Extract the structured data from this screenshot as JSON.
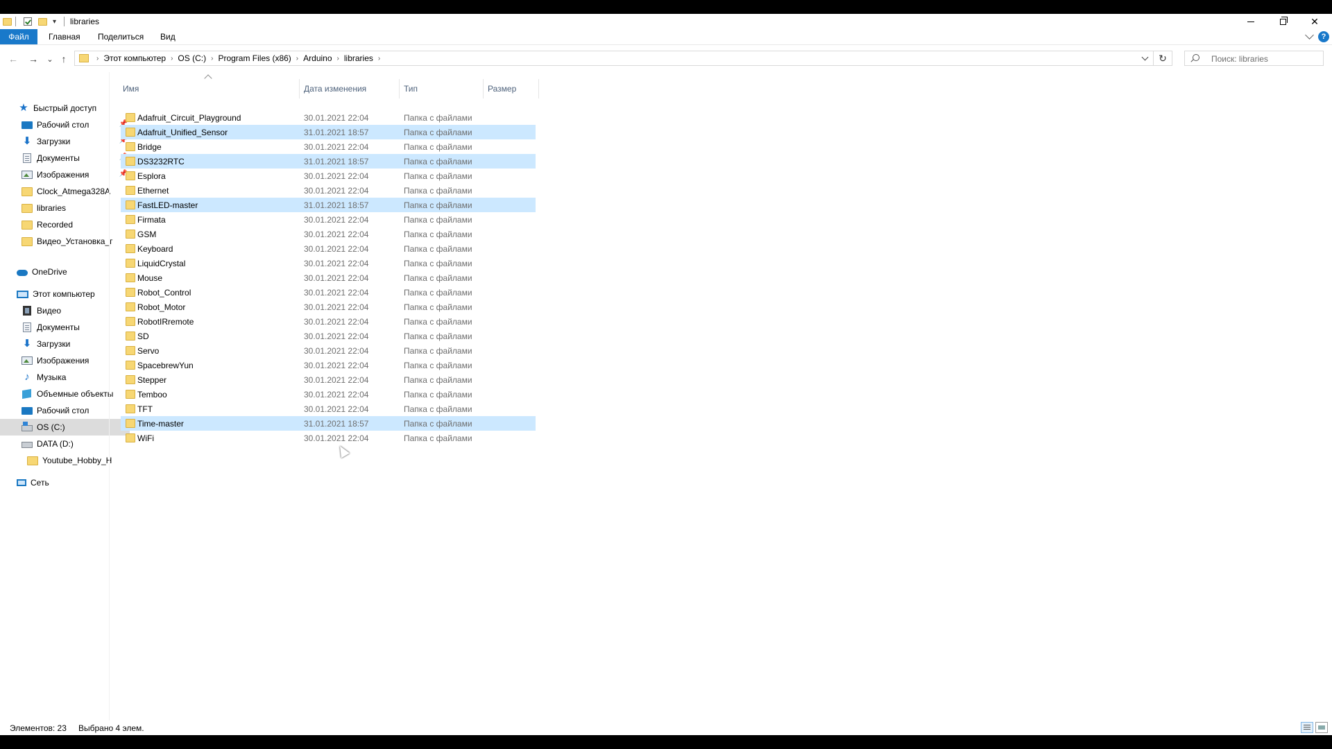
{
  "window": {
    "title": "libraries",
    "controls": {
      "minimize_icon": "minimize-icon",
      "maximize_icon": "restore-icon",
      "close_glyph": "✕"
    }
  },
  "ribbon": {
    "tabs": [
      "Файл",
      "Главная",
      "Поделиться",
      "Вид"
    ],
    "help_glyph": "?"
  },
  "nav": {
    "back_glyph": "←",
    "forward_glyph": "→",
    "recent_glyph": "⌄",
    "up_glyph": "↑",
    "refresh_glyph": "↻"
  },
  "address": {
    "crumbs": [
      "Этот компьютер",
      "OS (C:)",
      "Program Files (x86)",
      "Arduino",
      "libraries"
    ],
    "separator": "›"
  },
  "search": {
    "placeholder": "Поиск: libraries"
  },
  "navpane": {
    "quick_access": "Быстрый доступ",
    "quick_items": [
      "Рабочий стол",
      "Загрузки",
      "Документы",
      "Изображения",
      "Clock_Atmega328A",
      "libraries",
      "Recorded",
      "Видео_Установка_г"
    ],
    "onedrive": "OneDrive",
    "this_pc": "Этот компьютер",
    "pc_items": [
      "Видео",
      "Документы",
      "Загрузки",
      "Изображения",
      "Музыка",
      "Объемные объекты",
      "Рабочий стол",
      "OS (C:)",
      "DATA (D:)",
      "Youtube_Hobby_H"
    ],
    "network": "Сеть"
  },
  "columns": {
    "name": "Имя",
    "date": "Дата изменения",
    "type": "Тип",
    "size": "Размер"
  },
  "files": [
    {
      "name": "Adafruit_Circuit_Playground",
      "date": "30.01.2021 22:04",
      "type": "Папка с файлами",
      "selected": false
    },
    {
      "name": "Adafruit_Unified_Sensor",
      "date": "31.01.2021 18:57",
      "type": "Папка с файлами",
      "selected": true
    },
    {
      "name": "Bridge",
      "date": "30.01.2021 22:04",
      "type": "Папка с файлами",
      "selected": false
    },
    {
      "name": "DS3232RTC",
      "date": "31.01.2021 18:57",
      "type": "Папка с файлами",
      "selected": true
    },
    {
      "name": "Esplora",
      "date": "30.01.2021 22:04",
      "type": "Папка с файлами",
      "selected": false
    },
    {
      "name": "Ethernet",
      "date": "30.01.2021 22:04",
      "type": "Папка с файлами",
      "selected": false
    },
    {
      "name": "FastLED-master",
      "date": "31.01.2021 18:57",
      "type": "Папка с файлами",
      "selected": true
    },
    {
      "name": "Firmata",
      "date": "30.01.2021 22:04",
      "type": "Папка с файлами",
      "selected": false
    },
    {
      "name": "GSM",
      "date": "30.01.2021 22:04",
      "type": "Папка с файлами",
      "selected": false
    },
    {
      "name": "Keyboard",
      "date": "30.01.2021 22:04",
      "type": "Папка с файлами",
      "selected": false
    },
    {
      "name": "LiquidCrystal",
      "date": "30.01.2021 22:04",
      "type": "Папка с файлами",
      "selected": false
    },
    {
      "name": "Mouse",
      "date": "30.01.2021 22:04",
      "type": "Папка с файлами",
      "selected": false
    },
    {
      "name": "Robot_Control",
      "date": "30.01.2021 22:04",
      "type": "Папка с файлами",
      "selected": false
    },
    {
      "name": "Robot_Motor",
      "date": "30.01.2021 22:04",
      "type": "Папка с файлами",
      "selected": false
    },
    {
      "name": "RobotIRremote",
      "date": "30.01.2021 22:04",
      "type": "Папка с файлами",
      "selected": false
    },
    {
      "name": "SD",
      "date": "30.01.2021 22:04",
      "type": "Папка с файлами",
      "selected": false
    },
    {
      "name": "Servo",
      "date": "30.01.2021 22:04",
      "type": "Папка с файлами",
      "selected": false
    },
    {
      "name": "SpacebrewYun",
      "date": "30.01.2021 22:04",
      "type": "Папка с файлами",
      "selected": false
    },
    {
      "name": "Stepper",
      "date": "30.01.2021 22:04",
      "type": "Папка с файлами",
      "selected": false
    },
    {
      "name": "Temboo",
      "date": "30.01.2021 22:04",
      "type": "Папка с файлами",
      "selected": false
    },
    {
      "name": "TFT",
      "date": "30.01.2021 22:04",
      "type": "Папка с файлами",
      "selected": false
    },
    {
      "name": "Time-master",
      "date": "31.01.2021 18:57",
      "type": "Папка с файлами",
      "selected": true
    },
    {
      "name": "WiFi",
      "date": "30.01.2021 22:04",
      "type": "Папка с файлами",
      "selected": false
    }
  ],
  "status": {
    "count": "Элементов: 23",
    "selected": "Выбрано 4 элем."
  },
  "colors": {
    "accent": "#1979ca",
    "selection": "#cce8ff",
    "nav_selected": "#dcdcdc"
  }
}
